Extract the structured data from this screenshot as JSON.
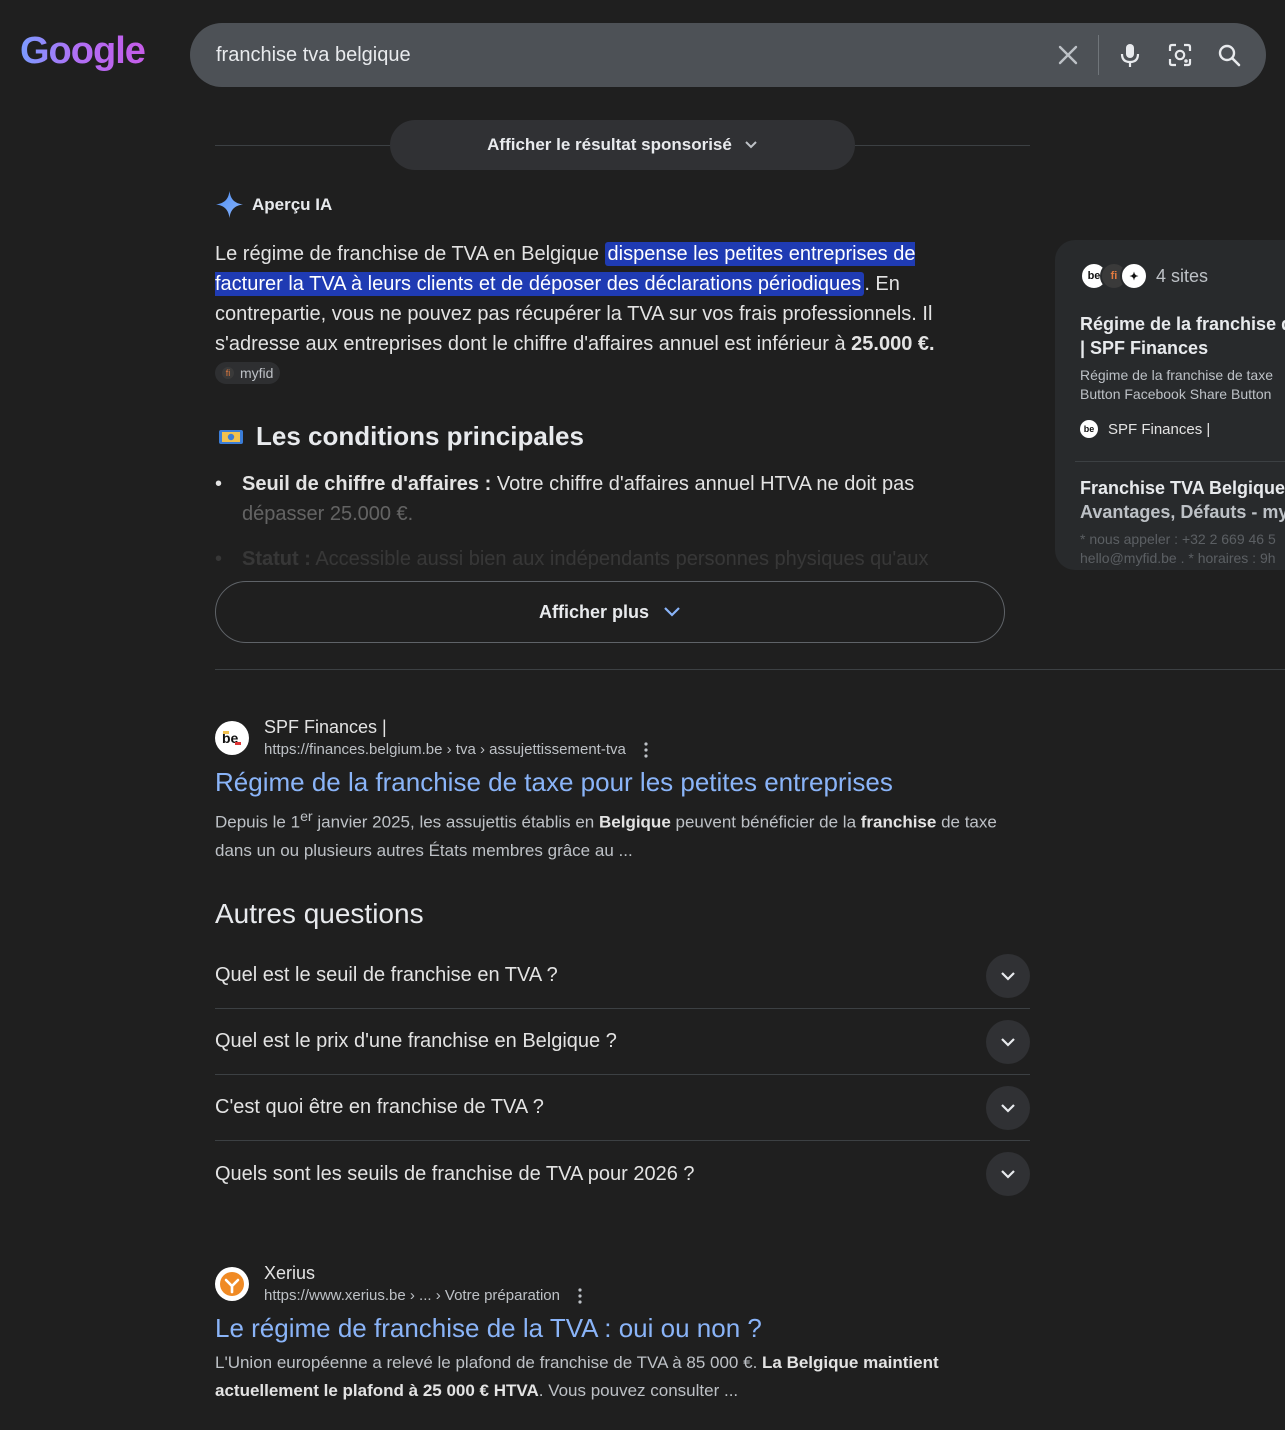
{
  "header": {
    "logo_text": "Google",
    "search_value": "franchise tva belgique"
  },
  "sponsored": {
    "label": "Afficher le résultat sponsorisé"
  },
  "ai_overview": {
    "title": "Aperçu IA",
    "summary_pre": "Le régime de franchise de TVA en Belgique ",
    "summary_highlight": "dispense les petites entreprises de facturer la TVA à leurs clients et de déposer des déclarations périodiques",
    "summary_post": ". En contrepartie, vous ne pouvez pas récupérer la TVA sur vos frais professionnels. Il s'adresse aux entreprises dont le chiffre d'affaires annuel est inférieur à ",
    "summary_bold": "25.000",
    "summary_end": " €.",
    "source_chip": "myfid",
    "conditions_title": "Les conditions principales",
    "bullets": [
      {
        "label": "Seuil de chiffre d'affaires :",
        "text_a": " Votre chiffre d'affaires annuel HTVA ne doit pas",
        "text_b": "dépasser 25.000 €."
      },
      {
        "label": "Statut :",
        "text_a": " Accessible aussi bien aux indépendants personnes physiques qu'aux"
      }
    ],
    "show_more": "Afficher plus"
  },
  "side_panel": {
    "sites_label": "4 sites",
    "card1_title_l1": "Régime de la franchise de",
    "card1_title_l2": "| SPF Finances",
    "card1_snip_l1": "Régime de la franchise de taxe",
    "card1_snip_l2": "Button Facebook Share Button",
    "card1_source": "SPF Finances |",
    "card2_title_l1": "Franchise TVA Belgique :",
    "card2_title_l2": "Avantages, Défauts - myf",
    "card2_snip_l1": "* nous appeler : +32 2 669 46 5",
    "card2_snip_l2": "hello@myfid.be . * horaires : 9h"
  },
  "results": [
    {
      "site": "SPF Finances |",
      "url": "https://finances.belgium.be › tva › assujettissement-tva",
      "title": "Régime de la franchise de taxe pour les petites entreprises",
      "snip_1": "Depuis le 1",
      "snip_sup": "er",
      "snip_2": " janvier 2025, les assujettis établis en ",
      "snip_b1": "Belgique",
      "snip_3": " peuvent bénéficier de la ",
      "snip_b2": "franchise",
      "snip_4": " de taxe dans un ou plusieurs autres États membres grâce au ..."
    },
    {
      "site": "Xerius",
      "url": "https://www.xerius.be › ... › Votre préparation",
      "title": "Le régime de franchise de la TVA : oui ou non ?",
      "snip_1": "L'Union européenne a relevé le plafond de franchise de TVA à 85 000 €. ",
      "snip_b1": "La Belgique maintient actuellement le plafond à 25 000 € HTVA",
      "snip_2": ". Vous pouvez consulter ..."
    }
  ],
  "paa": {
    "title": "Autres questions",
    "questions": [
      "Quel est le seuil de franchise en TVA ?",
      "Quel est le prix d'une franchise en Belgique ?",
      "C'est quoi être en franchise de TVA ?",
      "Quels sont les seuils de franchise de TVA pour 2026 ?"
    ]
  },
  "colors": {
    "background": "#1f1f1f",
    "link": "#8ab4f8",
    "highlight": "#1f3bb3",
    "search_bar": "#4d5156"
  }
}
